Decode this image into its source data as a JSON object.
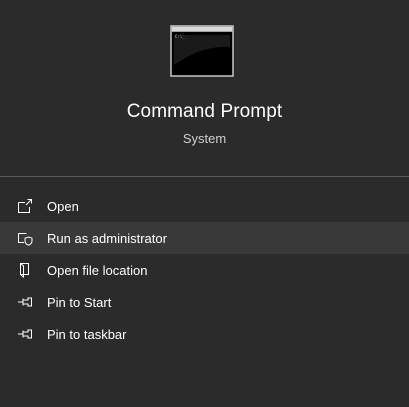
{
  "app": {
    "title": "Command Prompt",
    "subtitle": "System",
    "icon": "command-prompt-icon"
  },
  "menu": {
    "items": [
      {
        "label": "Open",
        "icon": "open-icon",
        "hovered": false
      },
      {
        "label": "Run as administrator",
        "icon": "shield-icon",
        "hovered": true
      },
      {
        "label": "Open file location",
        "icon": "file-location-icon",
        "hovered": false
      },
      {
        "label": "Pin to Start",
        "icon": "pin-icon",
        "hovered": false
      },
      {
        "label": "Pin to taskbar",
        "icon": "pin-icon",
        "hovered": false
      }
    ]
  },
  "colors": {
    "background": "#2b2b2b",
    "hover": "#393939",
    "divider": "#5a5a5a",
    "text": "#ffffff",
    "subtext": "#cfcfcf"
  }
}
